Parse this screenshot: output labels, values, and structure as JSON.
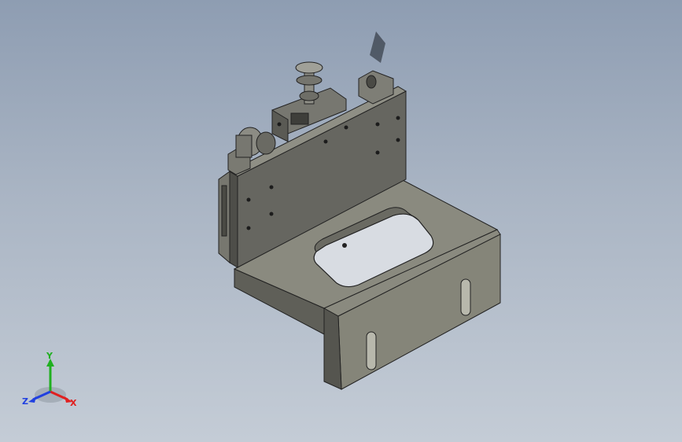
{
  "viewport": {
    "background_top": "#8e9db2",
    "background_bottom": "#c4ccd6",
    "part_color": "#6e6e68"
  },
  "triad": {
    "x_label": "X",
    "y_label": "Y",
    "z_label": "Z",
    "x_color": "#e02020",
    "y_color": "#20b020",
    "z_color": "#2040e0"
  }
}
